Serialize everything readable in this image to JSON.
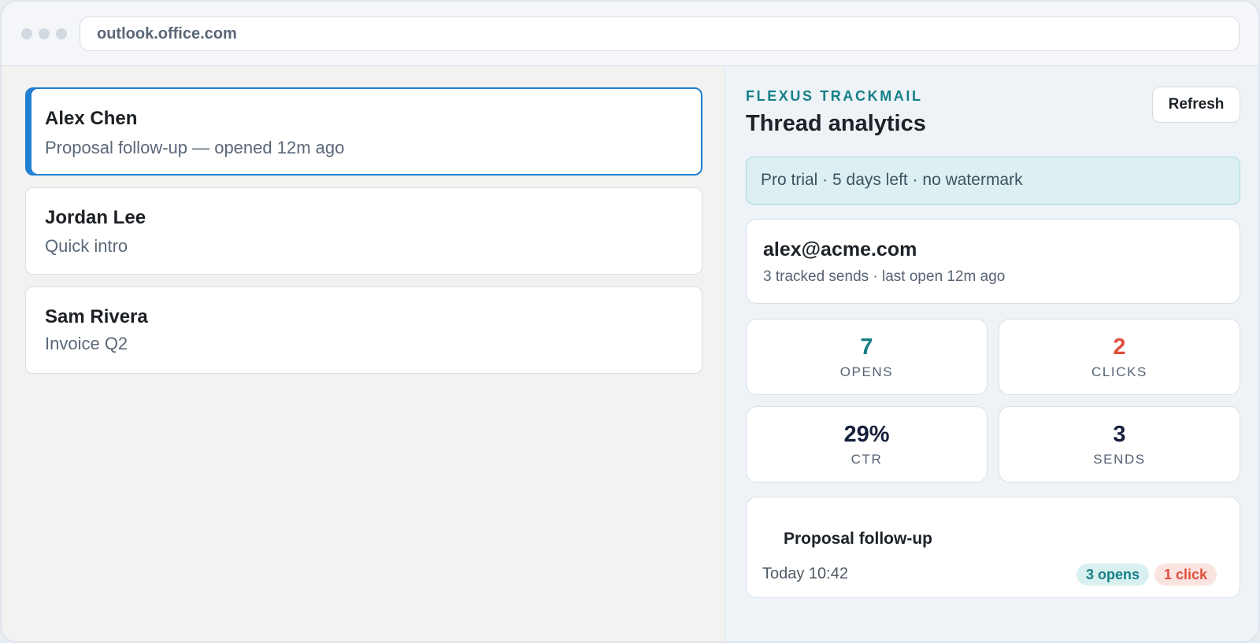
{
  "browser": {
    "url": "outlook.office.com"
  },
  "mail_list": [
    {
      "sender": "Alex Chen",
      "subject": "Proposal follow-up — opened 12m ago",
      "selected": true
    },
    {
      "sender": "Jordan Lee",
      "subject": "Quick intro",
      "selected": false
    },
    {
      "sender": "Sam Rivera",
      "subject": "Invoice Q2",
      "selected": false
    }
  ],
  "panel": {
    "brand": "FLEXUS TRACKMAIL",
    "title": "Thread analytics",
    "refresh_label": "Refresh",
    "trial_notice": "Pro trial · 5 days left · no watermark",
    "contact": {
      "email": "alex@acme.com",
      "meta": "3 tracked sends · last open 12m ago"
    },
    "stats": [
      {
        "value": "7",
        "label": "OPENS",
        "color": "#157f86"
      },
      {
        "value": "2",
        "label": "CLICKS",
        "color": "#e04f3c"
      },
      {
        "value": "29%",
        "label": "CTR",
        "color": "#15203a"
      },
      {
        "value": "3",
        "label": "SENDS",
        "color": "#15203a"
      }
    ],
    "thread": {
      "subject": "Proposal follow-up",
      "time": "Today 10:42",
      "opens_badge": "3 opens",
      "clicks_badge": "1 click"
    }
  },
  "colors": {
    "accent": "#1f7fd1",
    "brand": "#157f86",
    "clicks": "#e04f3c"
  }
}
